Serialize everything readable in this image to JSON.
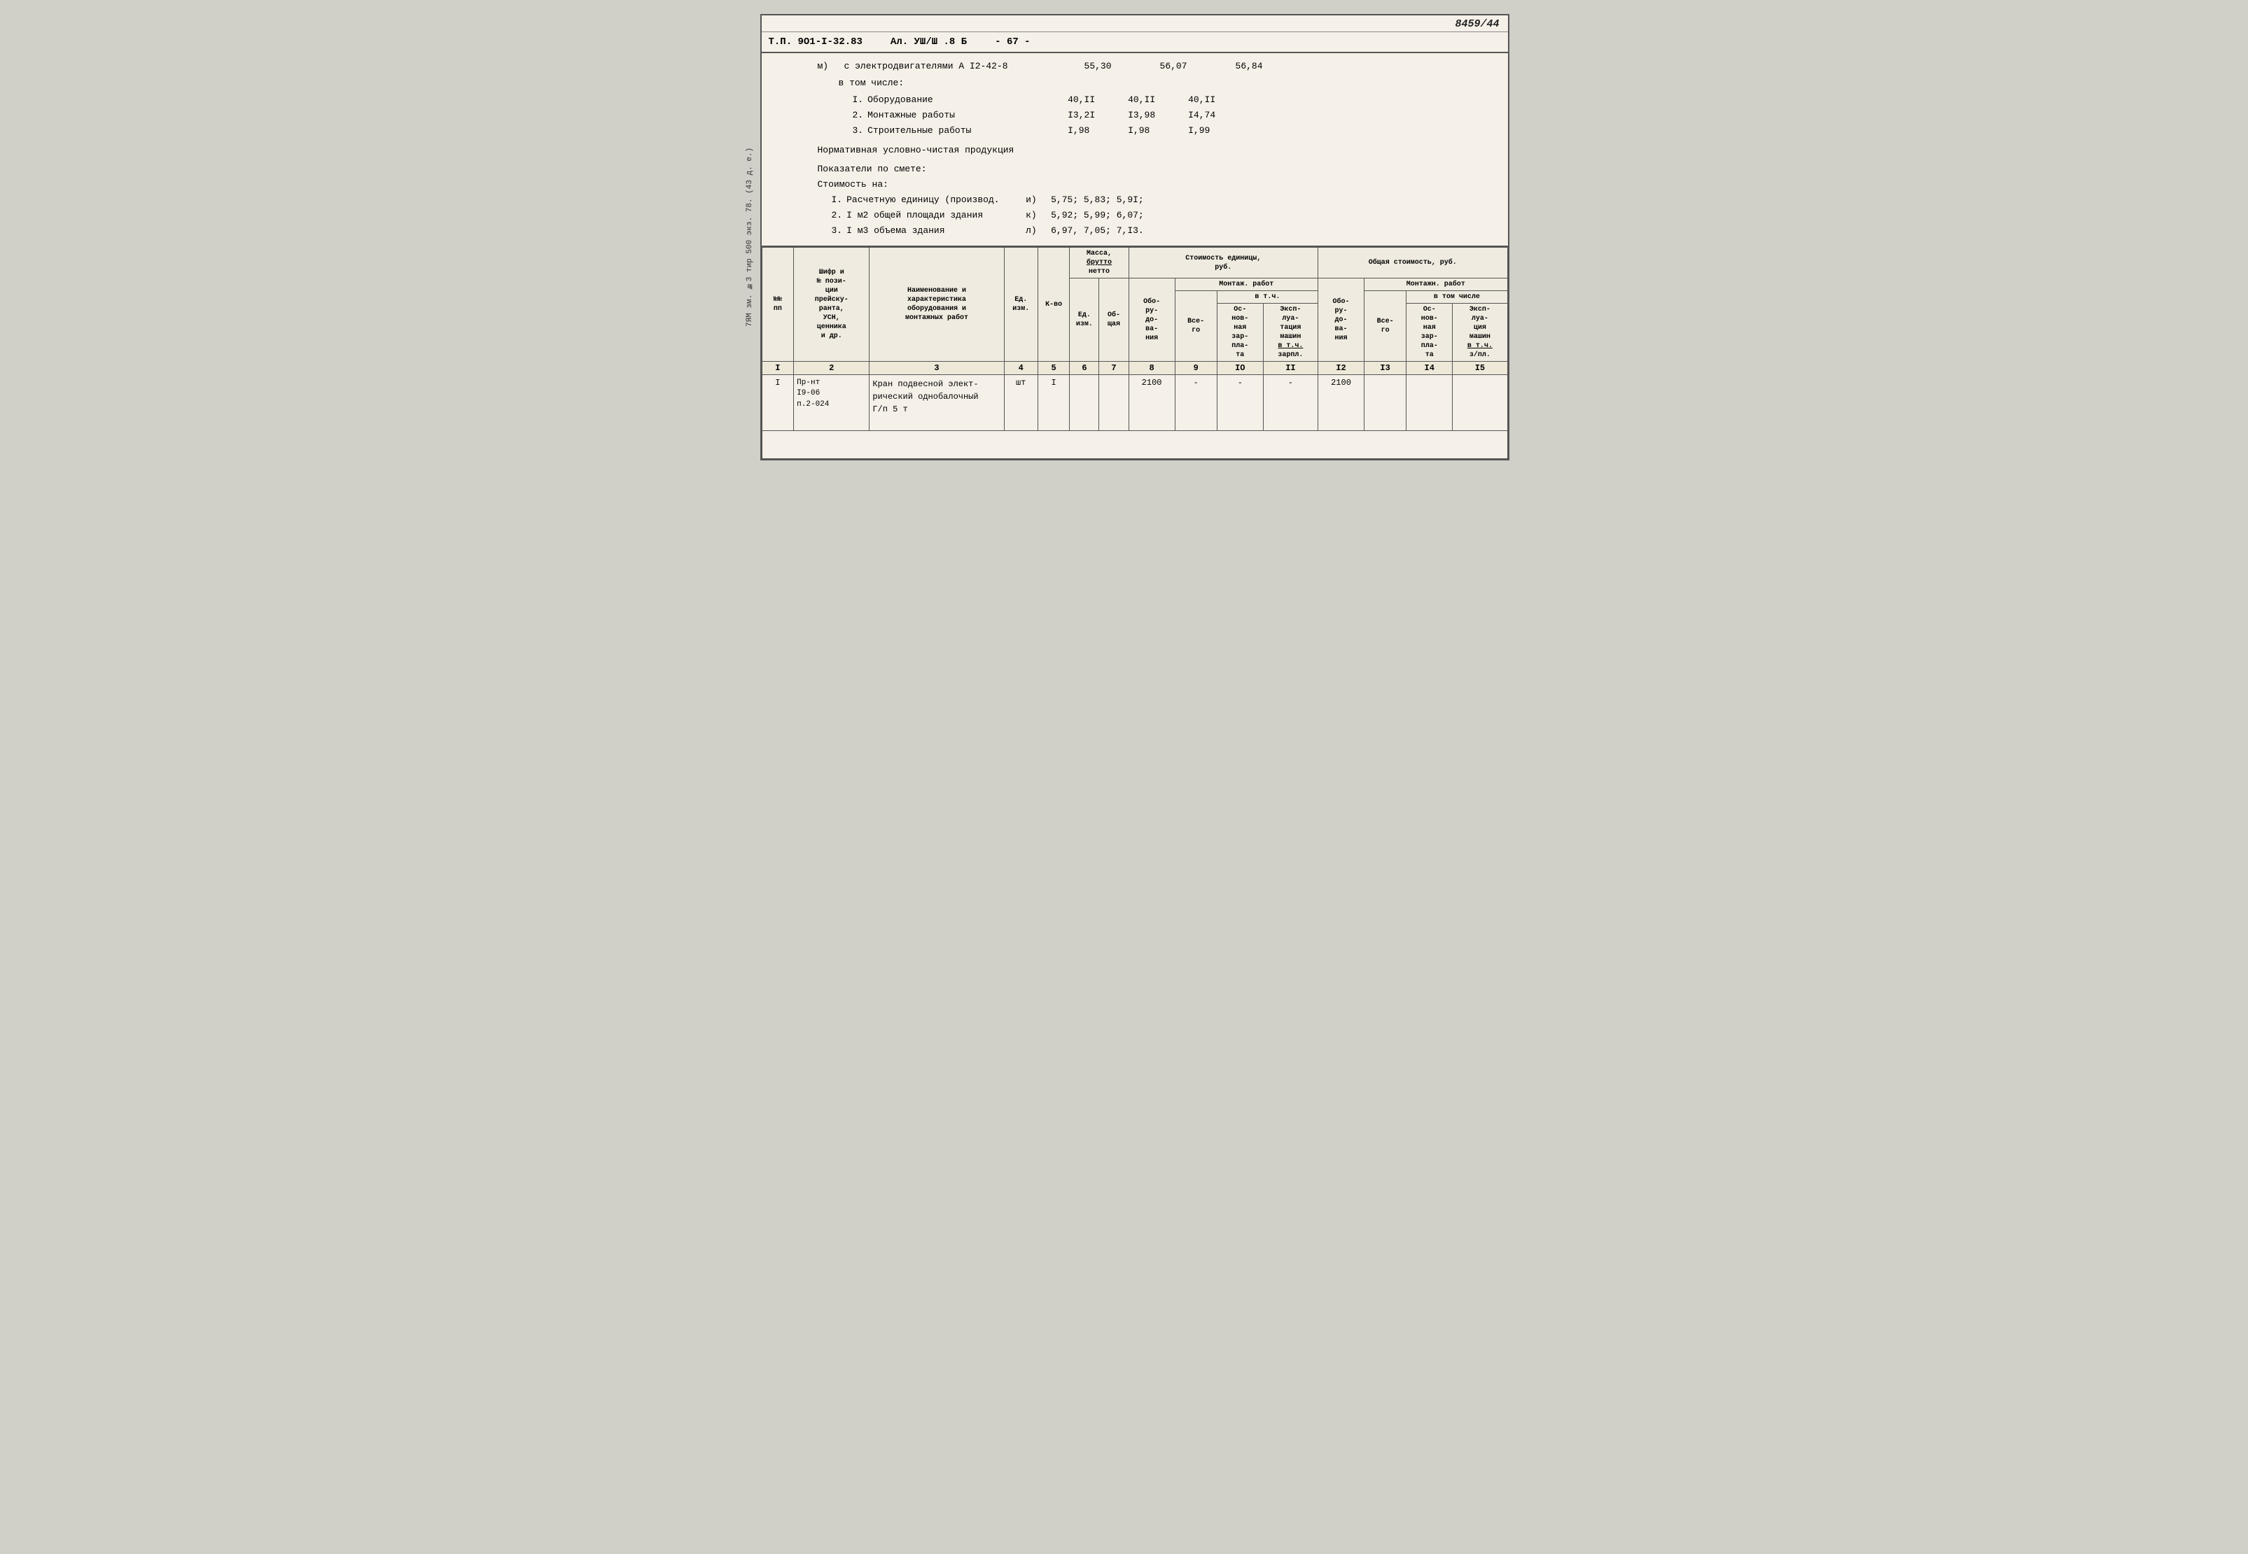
{
  "doc_number": "8459/44",
  "header": {
    "tp": "Т.П. 9О1-I-32.83",
    "al": "Ал. УШ/Ш .8 Б",
    "page": "- 67 -"
  },
  "motor_section": {
    "label": "м)",
    "description": "с электродвигателями А I2-42-8",
    "values": [
      "55,30",
      "56,07",
      "56,84"
    ],
    "sub_label": "в том числе:",
    "items": [
      {
        "num": "I.",
        "name": "Оборудование",
        "vals": [
          "40,II",
          "40,II",
          "40,II"
        ]
      },
      {
        "num": "2.",
        "name": "Монтажные работы",
        "vals": [
          "I3,2I",
          "I3,98",
          "I4,74"
        ]
      },
      {
        "num": "3.",
        "name": "Строительные работы",
        "vals": [
          "I,98",
          "I,98",
          "I,99"
        ]
      }
    ],
    "normative": "Нормативная условно-чистая продукция",
    "indicators_title": "Показатели по смете:",
    "cost_title": "Стоимость на:",
    "cost_items": [
      {
        "num": "I.",
        "name": "Расчетную единицу (произвол.",
        "letter": "и)",
        "vals": "5,75;  5,83; 5,9I;"
      },
      {
        "num": "2.",
        "name": "I м2 общей площади здания",
        "letter": "к)",
        "vals": "5,92;  5,99; 6,07;"
      },
      {
        "num": "3.",
        "name": "I м3 объема здания",
        "letter": "л)",
        "vals": "6,97,  7,05; 7,I3."
      }
    ]
  },
  "table": {
    "col_headers_row1": [
      "№№ пп",
      "Шифр и № пози- ции прейску- ранта, УСН, ценника и др.",
      "Наименование и характеристика оборудования и монтажных работ",
      "Ед. изм.",
      "К-во",
      "Масса, брутто нетто",
      "",
      "Стоимость единицы, руб.",
      "",
      "",
      "",
      "Общая стоимость, руб.",
      "",
      "",
      ""
    ],
    "mass_sub": [
      "Ед. изм.",
      "Об- щая"
    ],
    "cost_unit_sub": [
      "Обо- ру- до- ва- ния",
      "Монтаж. работ",
      "",
      ""
    ],
    "montazh_sub": [
      "Все- го",
      "Ос- нов- ная зар- пла- та",
      "Эксп- луа- ция машин в т.ч. зарпл."
    ],
    "total_sub": [
      "Обо- ру- до- ва- ния",
      "Монтажн. работ",
      "",
      ""
    ],
    "total_montazh_sub": [
      "Все- го",
      "Ос- нов- ная зар- пла- та",
      "Эксп- луа- ция машин в т.ч. з/пл."
    ],
    "col_numbers": [
      "I",
      "2",
      "3",
      "4",
      "5",
      "6",
      "7",
      "8",
      "9",
      "IO",
      "II",
      "I2",
      "I3",
      "I4",
      "I5"
    ],
    "data_rows": [
      {
        "num": "I",
        "code": "Пр-нт\nI9-06\nп.2-024",
        "name": "Кран подвесной элект-\nрический однобалочный\nГ/п 5 т",
        "unit": "шт",
        "qty": "I",
        "mass_unit": "",
        "mass_total": "",
        "oborud": "2100",
        "montazh_vsego": "-",
        "montazh_osnov": "-",
        "montazh_eksp": "-",
        "total_oborud": "2100",
        "total_vsego": "",
        "total_osnov": "",
        "total_eksp": ""
      }
    ]
  }
}
